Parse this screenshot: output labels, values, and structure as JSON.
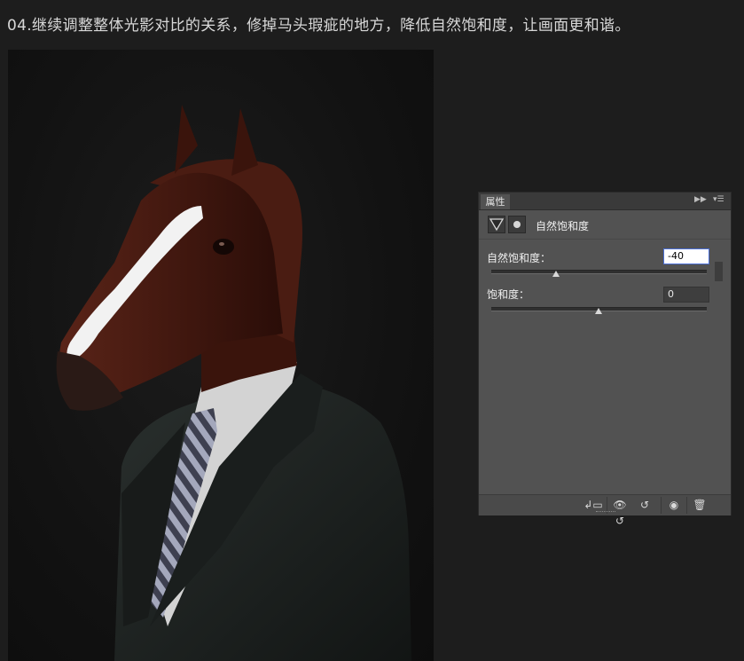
{
  "title": "04.继续调整整体光影对比的关系，修掉马头瑕疵的地方，降低自然饱和度，让画面更和谐。",
  "panel": {
    "tab_label": "属性",
    "collapse_icon": "double-arrow-right-icon",
    "menu_icon": "panel-menu-icon",
    "adjustment_title": "自然饱和度",
    "vibrance": {
      "label": "自然饱和度：",
      "value": "-40",
      "level": -40
    },
    "saturation": {
      "label": "饱和度：",
      "value": "0",
      "level": 0
    },
    "footer_icons": [
      "clip-to-layer-icon",
      "view-previous-icon",
      "reset-icon",
      "visibility-icon",
      "trash-icon"
    ]
  },
  "colors": {
    "page_bg": "#1d1d1d",
    "panel_bg": "#525252",
    "panel_header": "#3a3a3a",
    "horse": "#4a1c12",
    "suit": "#1f2422",
    "shirt": "#d8d8d8",
    "tie_stripe": "#8a8ea4"
  }
}
